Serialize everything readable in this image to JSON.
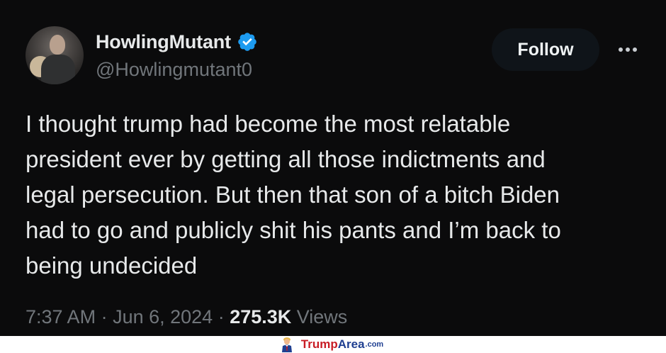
{
  "tweet": {
    "display_name": "HowlingMutant",
    "handle": "@Howlingmutant0",
    "follow_label": "Follow",
    "text": "I thought trump had become the most relatable\npresident ever by getting all those indictments and\nlegal persecution.  But then that son of a bitch Biden\nhad to go and publicly shit his pants and I’m back to\nbeing undecided",
    "time": "7:37 AM",
    "separator": " · ",
    "date": "Jun 6, 2024",
    "views_count": "275.3K",
    "views_label": " Views"
  },
  "icons": {
    "verified": "verified-badge-icon",
    "more": "more-horizontal-icon"
  },
  "footer": {
    "brand_trump": "Trump",
    "brand_area": "Area",
    "brand_com": ".com"
  },
  "colors": {
    "background": "#0b0b0c",
    "text_primary": "#e7e9ea",
    "text_secondary": "#71767b",
    "verified_blue": "#1d9bf0",
    "brand_red": "#c81d25",
    "brand_blue": "#1f3f91"
  }
}
